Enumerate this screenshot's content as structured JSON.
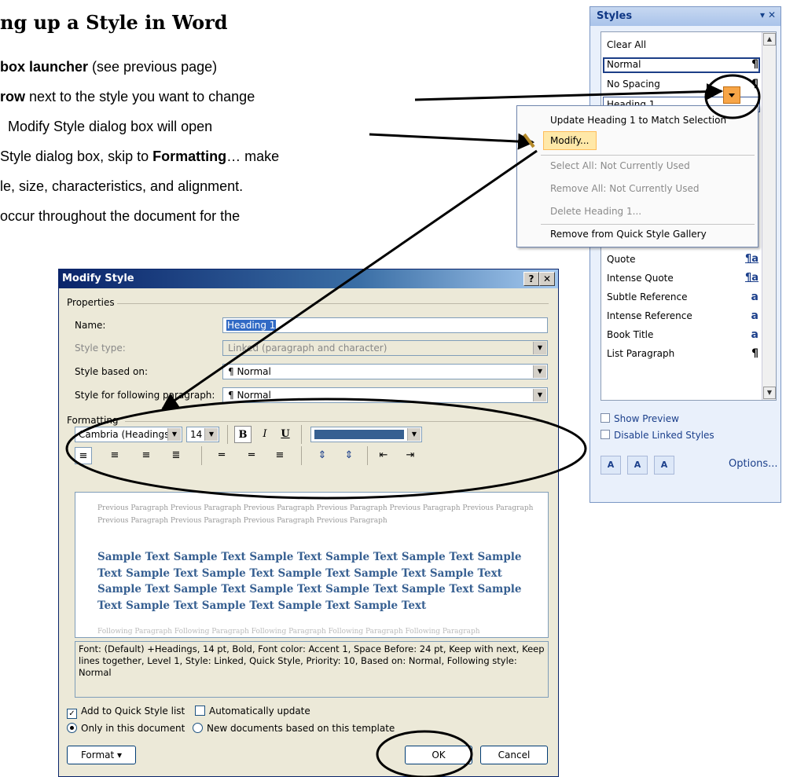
{
  "doc": {
    "title": "ng up a Style in Word",
    "lines": [
      {
        "b": "box launcher",
        "t": " (see previous page)"
      },
      {
        "b": "row",
        "t": " next to the style you want to change"
      },
      {
        "b": "",
        "t": "Modify Style dialog box will open"
      },
      {
        "b": "",
        "t": "Style dialog box, skip to ",
        "b2": "Formatting",
        "t2": "… make"
      },
      {
        "b": "",
        "t": "le, size, characteristics, and alignment."
      },
      {
        "b": "",
        "t": "occur throughout the document for the"
      }
    ]
  },
  "styles_pane": {
    "title": "Styles",
    "items_top": [
      "Clear All",
      "Normal",
      "No Spacing",
      "Heading 1"
    ],
    "items_bottom": [
      {
        "label": "Quote",
        "glyph": "¶a"
      },
      {
        "label": "Intense Quote",
        "glyph": "¶a"
      },
      {
        "label": "Subtle Reference",
        "glyph": "a"
      },
      {
        "label": "Intense Reference",
        "glyph": "a"
      },
      {
        "label": "Book Title",
        "glyph": "a"
      },
      {
        "label": "List Paragraph",
        "glyph": "¶"
      }
    ],
    "para_glyph": "¶",
    "show_preview": "Show Preview",
    "disable_linked": "Disable Linked Styles",
    "options": "Options..."
  },
  "context_menu": {
    "update": "Update Heading 1 to Match Selection",
    "modify": "Modify...",
    "select_all": "Select All: Not Currently Used",
    "remove_all": "Remove All: Not Currently Used",
    "delete": "Delete Heading 1...",
    "remove_gallery": "Remove from Quick Style Gallery"
  },
  "dialog": {
    "title": "Modify Style",
    "properties_label": "Properties",
    "name_label": "Name:",
    "name_value": "Heading 1",
    "style_type_label": "Style type:",
    "style_type_value": "Linked (paragraph and character)",
    "based_on_label": "Style based on:",
    "based_on_value": "¶ Normal",
    "following_label": "Style for following paragraph:",
    "following_value": "¶ Normal",
    "formatting_label": "Formatting",
    "font": "Cambria (Headings)",
    "size": "14",
    "font_color": "#365f91",
    "preview_previous": "Previous Paragraph Previous Paragraph Previous Paragraph Previous Paragraph Previous Paragraph Previous Paragraph Previous Paragraph Previous Paragraph Previous Paragraph Previous Paragraph",
    "preview_sample": "Sample Text Sample Text Sample Text Sample Text Sample Text Sample Text Sample Text Sample Text Sample Text Sample Text Sample Text Sample Text Sample Text Sample Text Sample Text Sample Text Sample Text Sample Text Sample Text Sample Text Sample Text",
    "preview_following": "Following Paragraph Following Paragraph Following Paragraph Following Paragraph Following Paragraph",
    "description": "Font: (Default) +Headings, 14 pt, Bold, Font color: Accent 1, Space Before:  24 pt, Keep with next, Keep lines together, Level 1, Style: Linked, Quick Style, Priority: 10, Based on: Normal, Following style: Normal",
    "add_quick": "Add to Quick Style list",
    "auto_update": "Automatically update",
    "only_doc": "Only in this document",
    "new_docs": "New documents based on this template",
    "format_btn": "Format ▾",
    "ok": "OK",
    "cancel": "Cancel"
  },
  "colors": {
    "accent": "#365f91",
    "orange": "#f7a547",
    "title_bar": "#0a246a"
  }
}
